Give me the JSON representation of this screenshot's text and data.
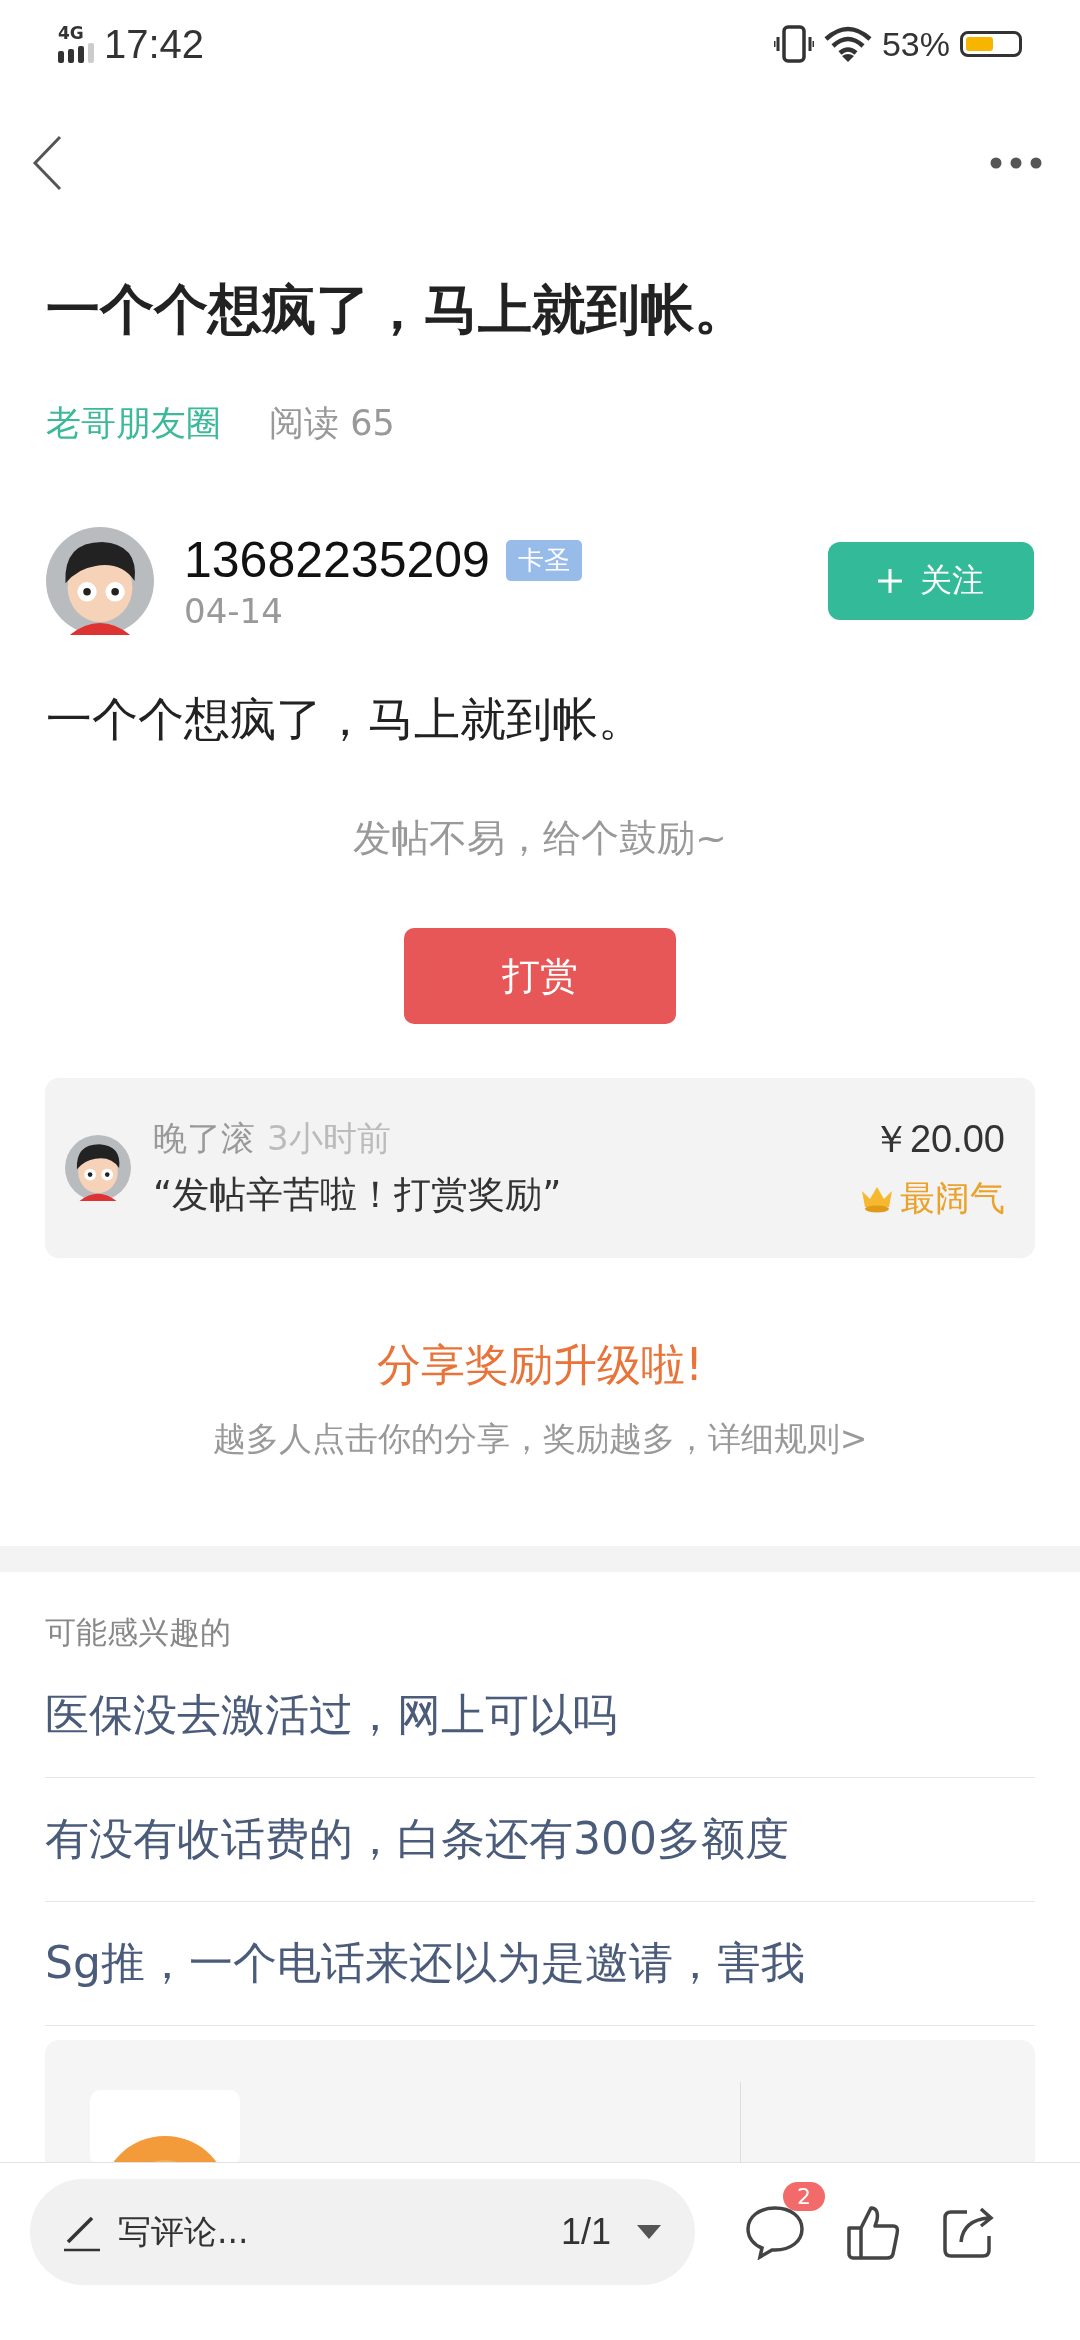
{
  "status_bar": {
    "network": "4G",
    "time": "17:42",
    "battery_text": "53%"
  },
  "title": "一个个想疯了，马上就到帐。",
  "meta": {
    "circle": "老哥朋友圈",
    "reads": "阅读 65"
  },
  "author": {
    "name": "13682235209",
    "badge": "卡圣",
    "date": "04-14",
    "follow": "关注"
  },
  "body": "一个个想疯了，马上就到帐。",
  "reward": {
    "prompt": "发帖不易，给个鼓励~",
    "button": "打赏",
    "records": [
      {
        "user": "晚了滚",
        "time": "3小时前",
        "message": "“发帖辛苦啦！打赏奖励”",
        "amount": "￥20.00",
        "tag": "最阔气"
      }
    ]
  },
  "share": {
    "title": "分享奖励升级啦!",
    "subtitle": "越多人点击你的分享，奖励越多，详细规则>"
  },
  "related": {
    "heading": "可能感兴趣的",
    "items": [
      {
        "text": "医保没去激活过，网上可以吗"
      },
      {
        "text": "有没有收话费的，白条还有300多额度"
      },
      {
        "text": "Sg推，一个电话来还以为是邀请，害我"
      }
    ]
  },
  "bottom_bar": {
    "placeholder": "写评论...",
    "page": "1/1",
    "comment_count": "2"
  }
}
